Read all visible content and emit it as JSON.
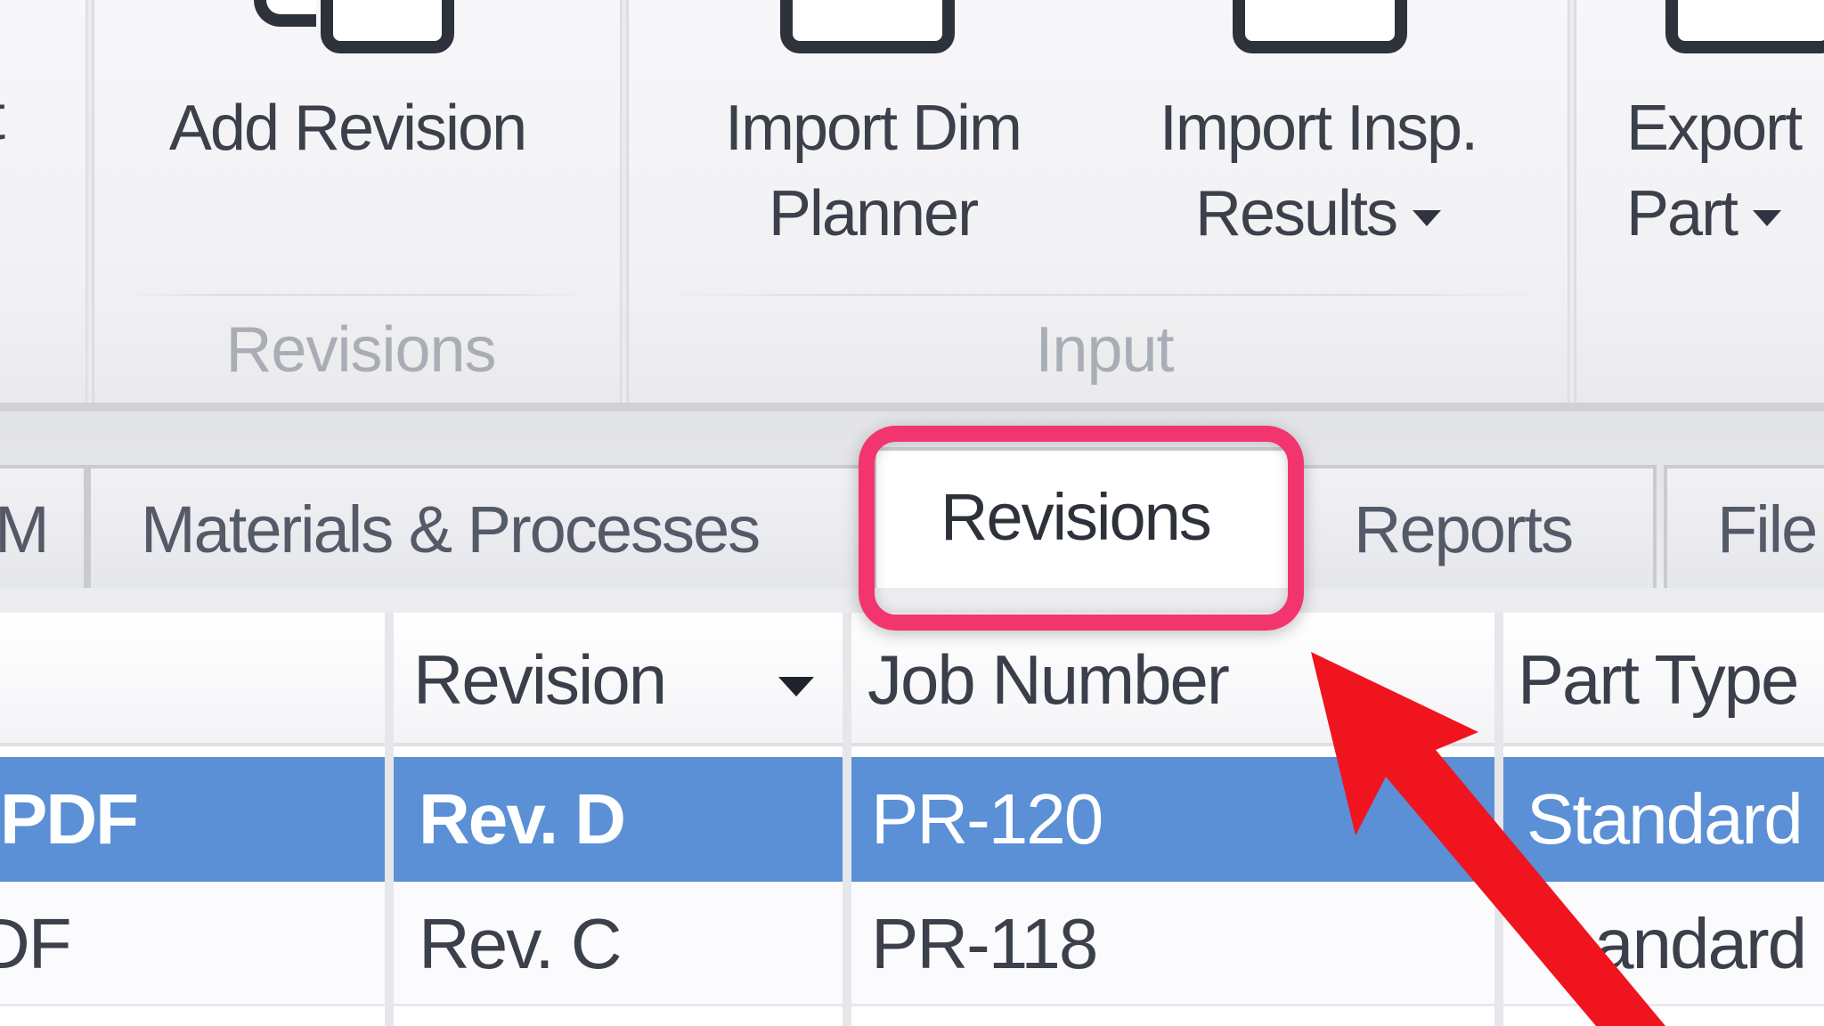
{
  "ribbon": {
    "buttons": {
      "partial_left": "t",
      "add_revision": "Add Revision",
      "import_dim_planner": [
        "Import Dim",
        "Planner"
      ],
      "import_insp_results": [
        "Import Insp.",
        "Results"
      ],
      "export_part": [
        "Export",
        "Part"
      ]
    },
    "groups": {
      "revisions": "Revisions",
      "input": "Input"
    }
  },
  "tabs": {
    "partial_left": "M",
    "materials_processes": "Materials & Processes",
    "revisions": "Revisions",
    "reports": "Reports",
    "files": "File"
  },
  "grid": {
    "columns": [
      "Revision",
      "Job Number",
      "Part Type"
    ],
    "rows": [
      {
        "first": "PDF",
        "revision": "Rev. D",
        "job_number": "PR-120",
        "part_type": "Standard",
        "selected": true
      },
      {
        "first": "DF",
        "revision": "Rev. C",
        "job_number": "PR-118",
        "part_type": "andard",
        "selected": false
      }
    ]
  },
  "colors": {
    "highlight": "#f2356e",
    "arrow": "#f0141e",
    "selection": "#5b8fd6"
  }
}
